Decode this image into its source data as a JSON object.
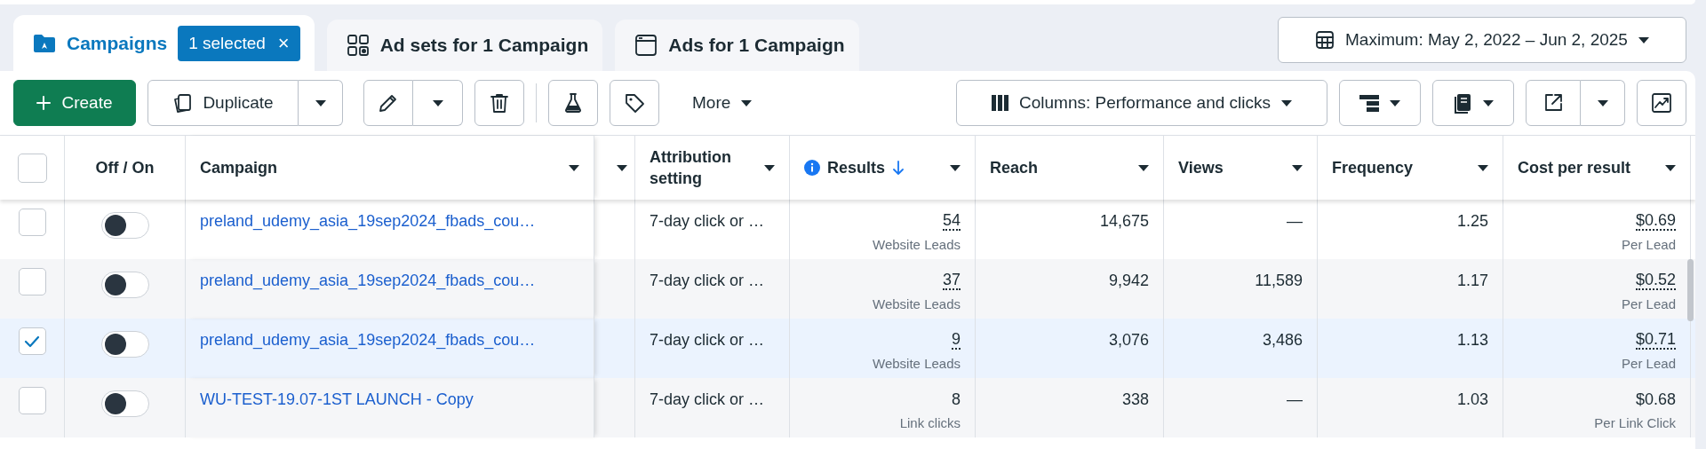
{
  "tabs": [
    {
      "kind": "campaigns",
      "label": "Campaigns",
      "selected": true,
      "badge": "1 selected",
      "badge_close": "×"
    },
    {
      "kind": "adsets",
      "label": "Ad sets for 1 Campaign",
      "selected": false
    },
    {
      "kind": "ads",
      "label": "Ads for 1 Campaign",
      "selected": false
    }
  ],
  "date_range": "Maximum: May 2, 2022 – Jun 2, 2025",
  "toolbar": {
    "create": "Create",
    "duplicate": "Duplicate",
    "more": "More",
    "columns": "Columns: Performance and clicks"
  },
  "table": {
    "header_checked": false,
    "columns": [
      {
        "label": "Off / On",
        "sorted": false,
        "info": false,
        "menu": false
      },
      {
        "label": "Campaign",
        "sorted": false,
        "info": false,
        "menu": true
      },
      {
        "sorted": false,
        "info": false,
        "menu": true
      },
      {
        "label": "Attribution setting",
        "sorted": false,
        "info": false,
        "menu": true
      },
      {
        "label": "Results",
        "sorted": true,
        "info": true,
        "menu": true
      },
      {
        "label": "Reach",
        "sorted": false,
        "info": false,
        "menu": true
      },
      {
        "label": "Views",
        "sorted": false,
        "info": false,
        "menu": true
      },
      {
        "label": "Frequency",
        "sorted": false,
        "info": false,
        "menu": true
      },
      {
        "label": "Cost per result",
        "sorted": false,
        "info": false,
        "menu": true
      }
    ],
    "rows": [
      {
        "selected": false,
        "on": false,
        "campaign": "preland_udemy_asia_19sep2024_fbads_cou…",
        "attribution": "7-day click or …",
        "results": "54",
        "results_unit": "Website Leads",
        "dotted": true,
        "reach": "14,675",
        "views": "—",
        "frequency": "1.25",
        "cost": "$0.69",
        "cost_unit": "Per Lead"
      },
      {
        "selected": false,
        "on": false,
        "campaign": "preland_udemy_asia_19sep2024_fbads_cou…",
        "attribution": "7-day click or …",
        "results": "37",
        "results_unit": "Website Leads",
        "dotted": true,
        "reach": "9,942",
        "views": "11,589",
        "frequency": "1.17",
        "cost": "$0.52",
        "cost_unit": "Per Lead"
      },
      {
        "selected": true,
        "on": false,
        "campaign": "preland_udemy_asia_19sep2024_fbads_cou…",
        "attribution": "7-day click or …",
        "results": "9",
        "results_unit": "Website Leads",
        "dotted": true,
        "reach": "3,076",
        "views": "3,486",
        "frequency": "1.13",
        "cost": "$0.71",
        "cost_unit": "Per Lead"
      },
      {
        "selected": false,
        "on": false,
        "campaign": "WU-TEST-19.07-1ST LAUNCH - Copy",
        "attribution": "7-day click or …",
        "results": "8",
        "results_unit": "Link clicks",
        "dotted": false,
        "reach": "338",
        "views": "—",
        "frequency": "1.03",
        "cost": "$0.68",
        "cost_unit": "Per Link Click"
      }
    ]
  }
}
